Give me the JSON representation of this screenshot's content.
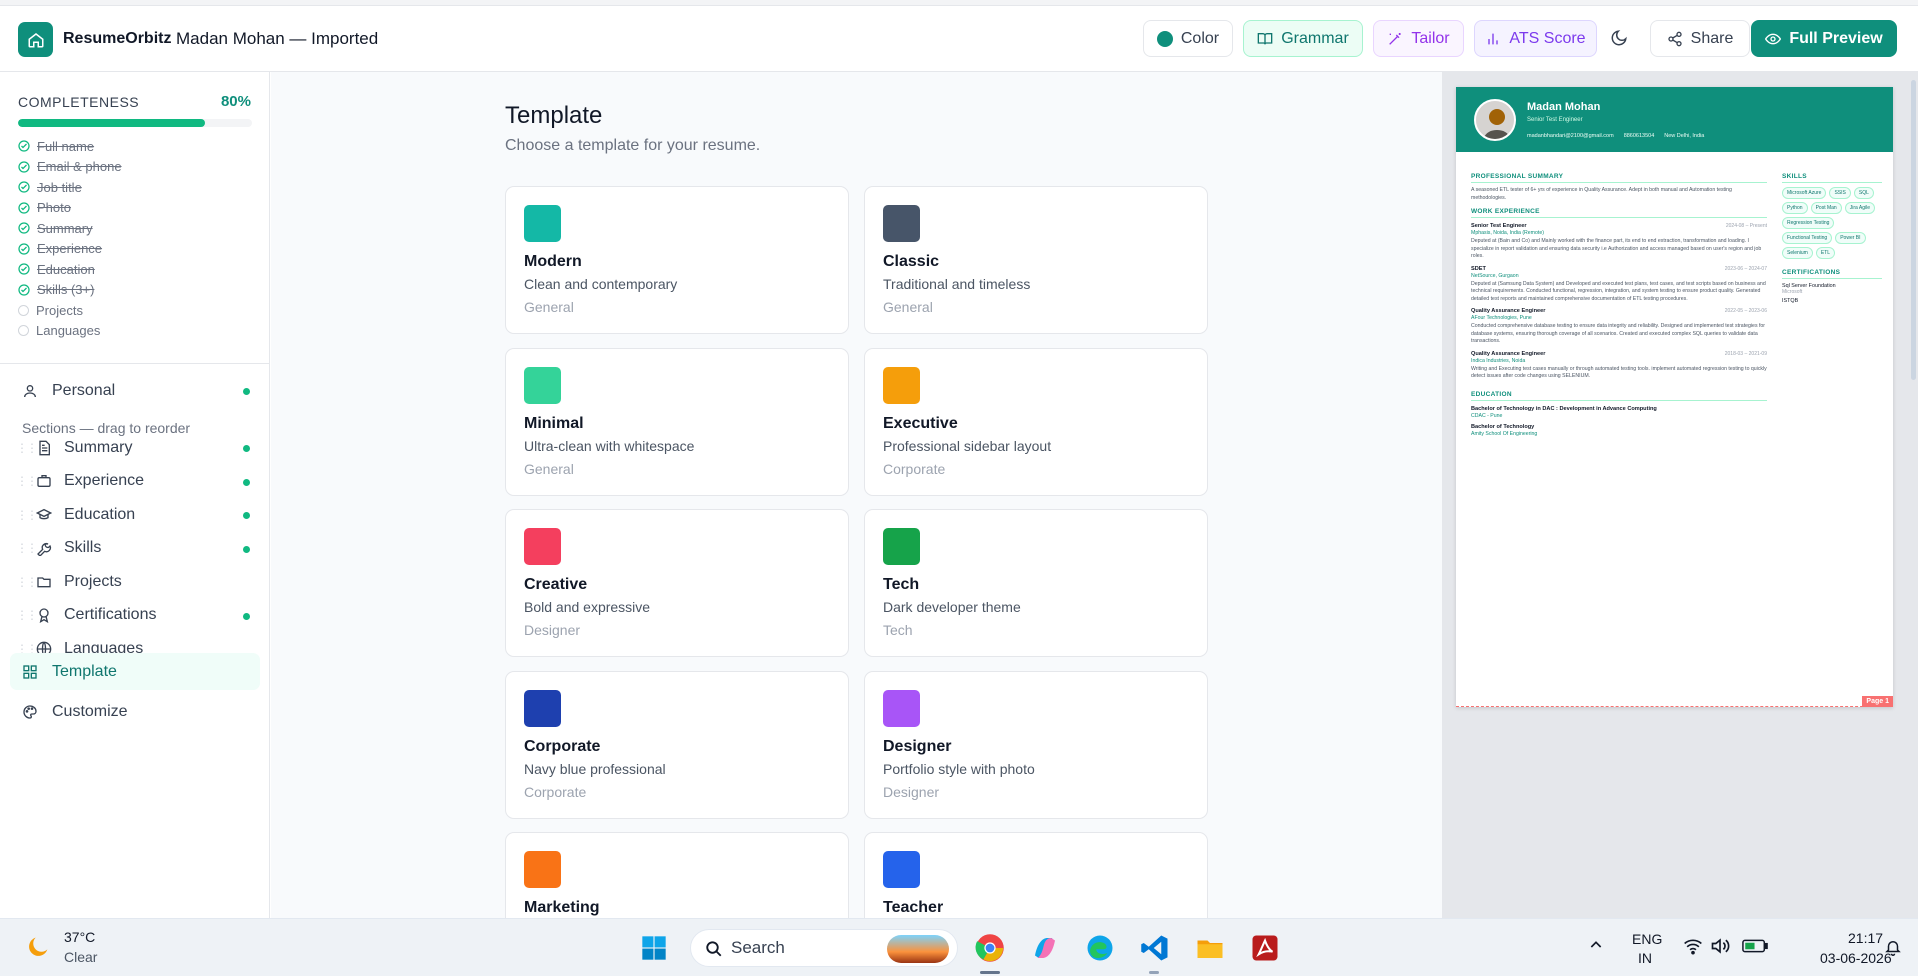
{
  "app": {
    "brand": "ResumeOrbitz",
    "document_title": "Madan Mohan — Imported"
  },
  "toolbar": {
    "color": "Color",
    "grammar": "Grammar",
    "tailor": "Tailor",
    "ats": "ATS Score",
    "share": "Share",
    "full_preview": "Full Preview"
  },
  "completeness": {
    "label": "COMPLETENESS",
    "percent_text": "80%",
    "percent": 80,
    "items": [
      {
        "label": "Full name",
        "done": true
      },
      {
        "label": "Email & phone",
        "done": true
      },
      {
        "label": "Job title",
        "done": true
      },
      {
        "label": "Photo",
        "done": true
      },
      {
        "label": "Summary",
        "done": true
      },
      {
        "label": "Experience",
        "done": true
      },
      {
        "label": "Education",
        "done": true
      },
      {
        "label": "Skills (3+)",
        "done": true
      },
      {
        "label": "Projects",
        "done": false
      },
      {
        "label": "Languages",
        "done": false
      }
    ]
  },
  "sidebar": {
    "personal": "Personal",
    "sections_label": "Sections — drag to reorder",
    "sections": [
      {
        "label": "Summary",
        "dot": true
      },
      {
        "label": "Experience",
        "dot": true
      },
      {
        "label": "Education",
        "dot": true
      },
      {
        "label": "Skills",
        "dot": true
      },
      {
        "label": "Projects",
        "dot": false
      },
      {
        "label": "Certifications",
        "dot": true
      },
      {
        "label": "Languages",
        "dot": false
      }
    ],
    "template": "Template",
    "customize": "Customize"
  },
  "main": {
    "title": "Template",
    "subtitle": "Choose a template for your resume.",
    "templates": [
      {
        "name": "Modern",
        "desc": "Clean and contemporary",
        "cat": "General",
        "color": "#14b8a6"
      },
      {
        "name": "Classic",
        "desc": "Traditional and timeless",
        "cat": "General",
        "color": "#475569"
      },
      {
        "name": "Minimal",
        "desc": "Ultra-clean with whitespace",
        "cat": "General",
        "color": "#34d399"
      },
      {
        "name": "Executive",
        "desc": "Professional sidebar layout",
        "cat": "Corporate",
        "color": "#f59e0b"
      },
      {
        "name": "Creative",
        "desc": "Bold and expressive",
        "cat": "Designer",
        "color": "#f43f5e"
      },
      {
        "name": "Tech",
        "desc": "Dark developer theme",
        "cat": "Tech",
        "color": "#16a34a"
      },
      {
        "name": "Corporate",
        "desc": "Navy blue professional",
        "cat": "Corporate",
        "color": "#1e40af"
      },
      {
        "name": "Designer",
        "desc": "Portfolio style with photo",
        "cat": "Designer",
        "color": "#a855f7"
      },
      {
        "name": "Marketing",
        "desc": "",
        "cat": "",
        "color": "#f97316"
      },
      {
        "name": "Teacher",
        "desc": "",
        "cat": "",
        "color": "#2563eb"
      }
    ]
  },
  "resume": {
    "name": "Madan Mohan",
    "role": "Senior Test Engineer",
    "email": "madanbhandari@2100@gmail.com",
    "phone": "8860613504",
    "location": "New Delhi, India",
    "summary_title": "PROFESSIONAL SUMMARY",
    "summary": "A seasoned ETL tester of 6+ yrs of experience in Quality Assurance. Adept in both manual and Automation testing methodologies.",
    "experience_title": "WORK EXPERIENCE",
    "jobs": [
      {
        "title": "Senior Test Engineer",
        "date": "2024-08 – Present",
        "company": "Mphasis, Noida, India (Remote)",
        "desc": "Deputed at (Bain and Co) and Mainly worked with the finance part, its end to end extraction, transformation and loading. I specialize in report validation and ensuring data security i.e Authorization and access managed based on user's region and job roles."
      },
      {
        "title": "SDET",
        "date": "2023-06 – 2024-07",
        "company": "NetSource, Gurgaon",
        "desc": "Deputed at (Samsung Data System) and Developed and executed test plans, test cases, and test scripts based on business and technical requirements. Conducted functional, regression, integration, and system testing to ensure product quality. Generated detailed test reports and maintained comprehensive documentation of ETL testing procedures."
      },
      {
        "title": "Quality Assurance Engineer",
        "date": "2022-05 – 2023-06",
        "company": "AFour Technologies, Pune",
        "desc": "Conducted comprehensive database testing to ensure data integrity and reliability. Designed and implemented test strategies for database systems, ensuring thorough coverage of all scenarios. Created and executed complex SQL queries to validate data transactions."
      },
      {
        "title": "Quality Assurance Engineer",
        "date": "2018-03 – 2021-09",
        "company": "Indica Industries, Noida",
        "desc": "Writing and Executing test cases manually or through automated testing tools. implement automated regression testing to quickly detect issues after code changes using SELENIUM."
      }
    ],
    "education_title": "EDUCATION",
    "education": [
      {
        "degree": "Bachelor of Technology in DAC : Development in Advance Computing",
        "school": "CDAC - Pune"
      },
      {
        "degree": "Bachelor of Technology",
        "school": "Amity School Of Engineering"
      }
    ],
    "skills_title": "SKILLS",
    "skills": [
      "Microsoft Azure",
      "SSIS",
      "SQL",
      "Python",
      "Post Man",
      "Jira Agile",
      "Regression Testing",
      "Functional Testing",
      "Power BI",
      "Selenium",
      "ETL"
    ],
    "cert_title": "CERTIFICATIONS",
    "certs": [
      {
        "name": "Sql Server Foundation",
        "org": "Microsoft"
      },
      {
        "name": "ISTQB",
        "org": ""
      }
    ],
    "page_label": "Page 1"
  },
  "taskbar": {
    "temp": "37°C",
    "condition": "Clear",
    "search": "Search",
    "lang1": "ENG",
    "lang2": "IN",
    "time": "21:17",
    "date": "03-06-2026"
  }
}
